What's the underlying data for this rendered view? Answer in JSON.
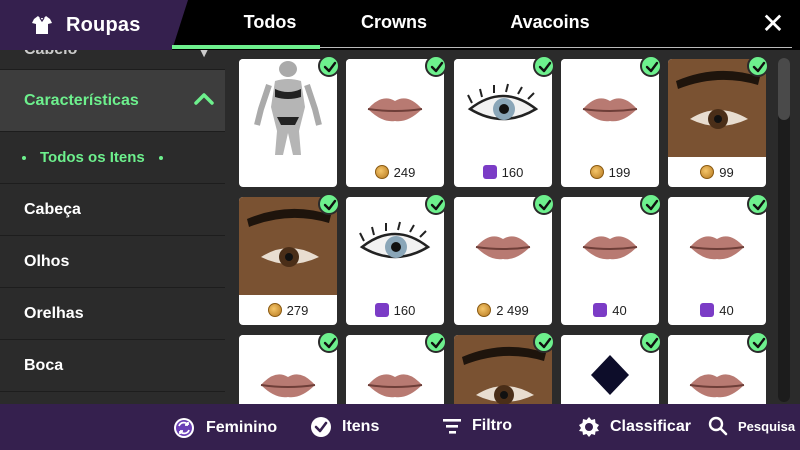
{
  "header": {
    "title": "Roupas",
    "tabs": [
      "Todos",
      "Crowns",
      "Avacoins"
    ]
  },
  "sidebar": {
    "items": [
      {
        "label": "Cabelo"
      },
      {
        "label": "Características"
      },
      {
        "label": "Todos os Itens"
      },
      {
        "label": "Cabeça"
      },
      {
        "label": "Olhos"
      },
      {
        "label": "Orelhas"
      },
      {
        "label": "Boca"
      }
    ]
  },
  "grid": {
    "items": [
      {
        "thumb": "body-icon",
        "currency": "",
        "price": ""
      },
      {
        "thumb": "lips-icon",
        "currency": "coin",
        "price": "249"
      },
      {
        "thumb": "eye-icon",
        "currency": "crown",
        "price": "160"
      },
      {
        "thumb": "lips-icon",
        "currency": "coin",
        "price": "199"
      },
      {
        "thumb": "brow-eye-icon",
        "currency": "coin",
        "price": "99"
      },
      {
        "thumb": "brow-eye-icon",
        "currency": "coin",
        "price": "279"
      },
      {
        "thumb": "eye-icon",
        "currency": "crown",
        "price": "160"
      },
      {
        "thumb": "lips-icon",
        "currency": "coin",
        "price": "2 499"
      },
      {
        "thumb": "lips-icon",
        "currency": "crown",
        "price": "40"
      },
      {
        "thumb": "lips-icon",
        "currency": "crown",
        "price": "40"
      },
      {
        "thumb": "lips-icon",
        "currency": "",
        "price": ""
      },
      {
        "thumb": "lips-icon",
        "currency": "",
        "price": ""
      },
      {
        "thumb": "brow-eye-icon",
        "currency": "",
        "price": ""
      },
      {
        "thumb": "diamond-icon",
        "currency": "",
        "price": ""
      },
      {
        "thumb": "lips-icon",
        "currency": "",
        "price": ""
      }
    ]
  },
  "bottombar": {
    "feminino": "Feminino",
    "itens": "Itens",
    "filtro": "Filtro",
    "classificar": "Classificar",
    "pesquisa": "Pesquisa"
  },
  "colors": {
    "accent": "#6df08d",
    "purple": "#35204e",
    "panel": "#2b2b2b"
  }
}
